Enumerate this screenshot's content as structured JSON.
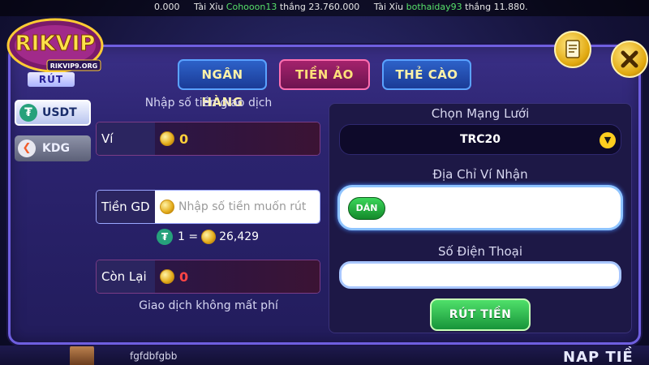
{
  "ticker": [
    {
      "game": "",
      "user": "",
      "verb": "",
      "amount": "0.000"
    },
    {
      "game": "Tài Xỉu",
      "user": "Cohooon13",
      "verb": "thắng",
      "amount": "23.760.000"
    },
    {
      "game": "Tài Xỉu",
      "user": "bothaiday93",
      "verb": "thắng",
      "amount": "11.880."
    }
  ],
  "logo": {
    "text": "RIKVIP",
    "url": "RIKVIP9.ORG"
  },
  "section_label": "RÚT",
  "tabs": [
    {
      "label": "NGÂN HÀNG",
      "active": false
    },
    {
      "label": "TIỀN ẢO",
      "active": true
    },
    {
      "label": "THẺ CÀO",
      "active": false
    }
  ],
  "currencies": [
    {
      "label": "USDT",
      "active": true
    },
    {
      "label": "KDG",
      "active": false
    }
  ],
  "left": {
    "title": "Nhập số tiền giao dịch",
    "wallet_label": "Ví",
    "wallet_value": "0",
    "amount_label": "Tiền GD",
    "amount_placeholder": "Nhập số tiền muốn rút",
    "rate_left": "1 =",
    "rate_right": "26,429",
    "remaining_label": "Còn Lại",
    "remaining_value": "0",
    "fee_note": "Giao dịch không mất phí"
  },
  "right": {
    "network_label": "Chọn Mạng Lưới",
    "network_value": "TRC20",
    "address_label": "Địa Chỉ Ví Nhận",
    "paste_label": "DÁN",
    "phone_label": "Số Điện Thoại",
    "withdraw_label": "RÚT TIỀN"
  },
  "bottom": {
    "player_name": "fgfdbfgbb",
    "banner": "NAP TIỀ"
  },
  "icons": {
    "history": "receipt-icon",
    "close": "close-icon",
    "dropdown": "chevron-down-icon"
  },
  "colors": {
    "active_tab": "#a4226c",
    "inactive_tab": "#2d62c9",
    "gold": "#ffcf3a",
    "remaining": "#ff4545",
    "withdraw": "#17943a"
  }
}
